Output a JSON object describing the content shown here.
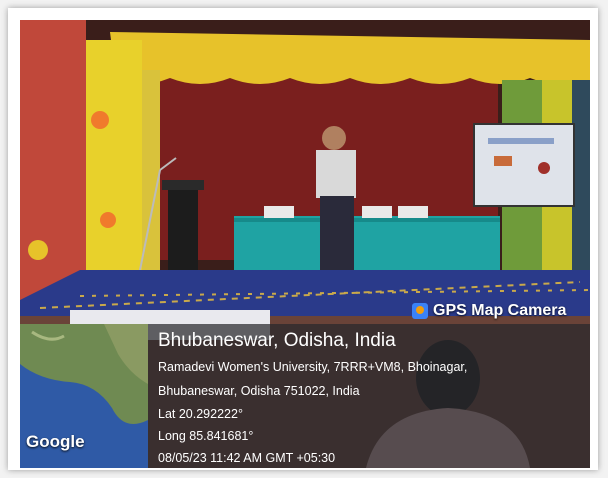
{
  "badge": {
    "label": "GPS Map Camera",
    "icon": "camera-icon"
  },
  "location": {
    "title": "Bhubaneswar, Odisha, India",
    "address_line1": "Ramadevi Women's University, 7RRR+VM8, Bhoinagar,",
    "address_line2": "Bhubaneswar, Odisha 751022, India",
    "lat": "Lat 20.292222°",
    "long": "Long 85.841681°",
    "timestamp": "08/05/23 11:42 AM GMT +05:30"
  },
  "map": {
    "brand": "Google"
  },
  "colors": {
    "curtain": "#b5872a",
    "stage_cloth": "#1fa3a3",
    "floor": "#2a3a8a"
  }
}
